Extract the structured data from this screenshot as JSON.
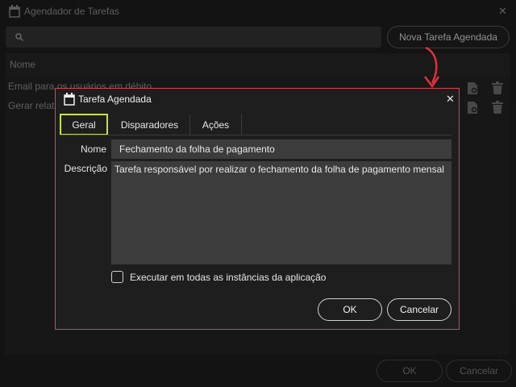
{
  "colors": {
    "accent_border": "#e0424e",
    "tab_highlight": "#c6e33a",
    "arrow": "#e0303c"
  },
  "background_window": {
    "title": "Agendador de Tarefas",
    "icon": "calendar-icon",
    "search": {
      "placeholder": "",
      "icon": "search-icon"
    },
    "new_task_button": "Nova Tarefa Agendada",
    "column_header": "Nome",
    "rows": [
      {
        "name": "Email para os usuários em débito"
      },
      {
        "name": "Gerar relat"
      }
    ],
    "row_actions": [
      "edit-icon",
      "trash-icon"
    ],
    "ok_label": "OK",
    "cancel_label": "Cancelar"
  },
  "dialog": {
    "title": "Tarefa Agendada",
    "icon": "calendar-icon",
    "tabs": [
      {
        "label": "Geral",
        "active": true
      },
      {
        "label": "Disparadores",
        "active": false
      },
      {
        "label": "Ações",
        "active": false
      }
    ],
    "nome_label": "Nome",
    "nome_value": "Fechamento da folha de pagamento",
    "descricao_label": "Descrição",
    "descricao_value": "Tarefa responsável por realizar o fechamento da folha de pagamento mensal",
    "checkbox_label": "Executar em todas as instâncias da aplicação",
    "checkbox_checked": false,
    "ok_label": "OK",
    "cancel_label": "Cancelar"
  }
}
